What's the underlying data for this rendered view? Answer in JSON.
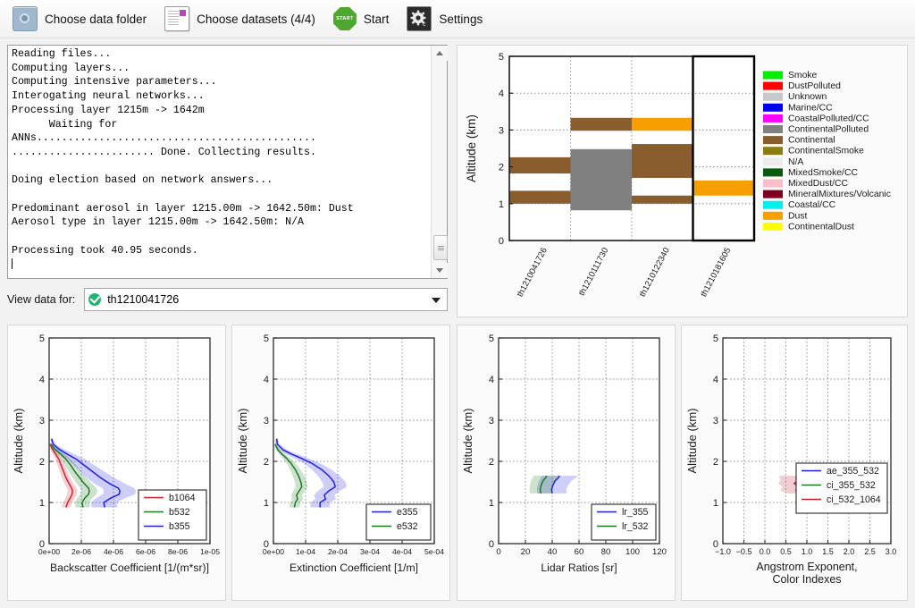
{
  "toolbar": {
    "buttons": [
      {
        "label": "Choose data folder",
        "icon": "folder-icon"
      },
      {
        "label": "Choose datasets (4/4)",
        "icon": "datasets-icon"
      },
      {
        "label": "Start",
        "icon": "start-icon",
        "icon_text": "START"
      },
      {
        "label": "Settings",
        "icon": "gear-icon"
      }
    ]
  },
  "console": {
    "text": "Reading files...\nComputing layers...\nComputing intensive parameters...\nInterogating neural networks...\nProcessing layer 1215m -> 1642m\n      Waiting for\nANNs.............................................\n....................... Done. Collecting results.\n\nDoing election based on network answers...\n\nPredominant aerosol in layer 1215.00m -> 1642.50m: Dust\nAerosol type in layer 1215.00m -> 1642.50m: N/A\n\nProcessing took 40.95 seconds."
  },
  "view_selector": {
    "label": "View data for:",
    "value": "th1210041726",
    "status_icon": "check-circle-icon"
  },
  "chart_data": [
    {
      "id": "classification",
      "type": "bar",
      "title": "",
      "xlabel": "",
      "ylabel": "Altitude (km)",
      "ylim": [
        0,
        5
      ],
      "yticks": [
        0,
        1,
        2,
        3,
        4,
        5
      ],
      "grid": true,
      "categories": [
        "th1210041726",
        "th1210111730",
        "th1210122340",
        "th1210181605"
      ],
      "highlighted_category": "th1210181605",
      "layers": [
        {
          "category": "th1210041726",
          "bottom": 1.0,
          "top": 1.35,
          "type": "Continental",
          "color": "#8a5d2e"
        },
        {
          "category": "th1210041726",
          "bottom": 1.82,
          "top": 2.26,
          "type": "Continental",
          "color": "#8a5d2e"
        },
        {
          "category": "th1210111730",
          "bottom": 0.82,
          "top": 2.48,
          "type": "ContinentalPolluted",
          "color": "#808080"
        },
        {
          "category": "th1210111730",
          "bottom": 2.98,
          "top": 3.33,
          "type": "Continental",
          "color": "#8a5d2e"
        },
        {
          "category": "th1210122340",
          "bottom": 1.0,
          "top": 1.22,
          "type": "Continental",
          "color": "#8a5d2e"
        },
        {
          "category": "th1210122340",
          "bottom": 1.7,
          "top": 2.62,
          "type": "Continental",
          "color": "#8a5d2e"
        },
        {
          "category": "th1210122340",
          "bottom": 2.98,
          "top": 3.33,
          "type": "Dust",
          "color": "#f5a000"
        },
        {
          "category": "th1210181605",
          "bottom": 1.22,
          "top": 1.63,
          "type": "Dust",
          "color": "#f5a000"
        }
      ],
      "legend_position": "right",
      "legend": [
        {
          "label": "Smoke",
          "color": "#00ee00"
        },
        {
          "label": "DustPolluted",
          "color": "#fe0000"
        },
        {
          "label": "Unknown",
          "color": "#c8c8c8"
        },
        {
          "label": "Marine/CC",
          "color": "#0000ee"
        },
        {
          "label": "CoastalPolluted/CC",
          "color": "#ff00ff"
        },
        {
          "label": "ContinentalPolluted",
          "color": "#808080"
        },
        {
          "label": "Continental",
          "color": "#8a5d2e"
        },
        {
          "label": "ContinentalSmoke",
          "color": "#8a7d12"
        },
        {
          "label": "N/A",
          "color": "#ececec"
        },
        {
          "label": "MixedSmoke/CC",
          "color": "#0a5a10"
        },
        {
          "label": "MixedDust/CC",
          "color": "#f9bfc8"
        },
        {
          "label": "MineralMixtures/Volcanic",
          "color": "#800020"
        },
        {
          "label": "Coastal/CC",
          "color": "#00f0f0"
        },
        {
          "label": "Dust",
          "color": "#f5a000"
        },
        {
          "label": "ContinentalDust",
          "color": "#ffff00"
        }
      ]
    },
    {
      "id": "backscatter",
      "type": "line",
      "xlabel": "Backscatter Coefficient [1/(m*sr)]",
      "ylabel": "Altitude (km)",
      "xlim": [
        0,
        1e-05
      ],
      "ylim": [
        0,
        5
      ],
      "xticks": [
        0,
        2e-06,
        4e-06,
        6e-06,
        8e-06,
        1e-05
      ],
      "xticklabels": [
        "0e+00",
        "2e-06",
        "4e-06",
        "6e-06",
        "8e-06",
        "1e-05"
      ],
      "yticks": [
        0,
        1,
        2,
        3,
        4,
        5
      ],
      "grid": true,
      "legend_position": "lower right",
      "series": [
        {
          "name": "b1064",
          "color": "#d02030",
          "y": [
            0.88,
            1.0,
            1.1,
            1.2,
            1.28,
            1.35,
            1.45,
            1.6,
            1.75,
            1.9,
            2.05,
            2.18,
            2.3,
            2.42
          ],
          "x": [
            1.05e-06,
            1.15e-06,
            1.3e-06,
            1.42e-06,
            1.45e-06,
            1.4e-06,
            1.25e-06,
            1.05e-06,
            9e-07,
            7.5e-07,
            6e-07,
            4e-07,
            2e-07,
            6e-08
          ],
          "band": [
            2.8e-07,
            2.8e-07,
            3e-07,
            3e-07,
            3e-07,
            3e-07,
            2.8e-07,
            2.6e-07,
            2.4e-07,
            2.2e-07,
            2e-07,
            1.8e-07,
            1.4e-07,
            8e-08
          ]
        },
        {
          "name": "b532",
          "color": "#1a7a20",
          "y": [
            0.88,
            1.0,
            1.1,
            1.2,
            1.28,
            1.35,
            1.45,
            1.6,
            1.75,
            1.9,
            2.05,
            2.18,
            2.3,
            2.42
          ],
          "x": [
            2.1e-06,
            2.05e-06,
            2.2e-06,
            2.45e-06,
            2.5e-06,
            2.45e-06,
            2.2e-06,
            1.9e-06,
            1.6e-06,
            1.35e-06,
            1.05e-06,
            7e-07,
            3.5e-07,
            1e-07
          ],
          "band": [
            4.5e-07,
            4.5e-07,
            4.8e-07,
            5e-07,
            5e-07,
            5e-07,
            4.8e-07,
            4.4e-07,
            4e-07,
            3.6e-07,
            3e-07,
            2.6e-07,
            2e-07,
            1e-07
          ]
        },
        {
          "name": "b355",
          "color": "#2020dd",
          "y": [
            0.88,
            1.0,
            1.1,
            1.2,
            1.28,
            1.35,
            1.45,
            1.6,
            1.75,
            1.9,
            2.05,
            2.18,
            2.3,
            2.42,
            2.55
          ],
          "x": [
            3.45e-06,
            3.4e-06,
            3.8e-06,
            4.35e-06,
            4.4e-06,
            4.3e-06,
            3.8e-06,
            3.2e-06,
            2.7e-06,
            2.2e-06,
            1.7e-06,
            1.1e-06,
            6e-07,
            2.5e-07,
            1.5e-07
          ],
          "band": [
            8e-07,
            8e-07,
            9e-07,
            1e-06,
            1e-06,
            1e-06,
            9.5e-07,
            8.5e-07,
            7.5e-07,
            6.5e-07,
            5.5e-07,
            4.5e-07,
            3e-07,
            1.5e-07,
            8e-08
          ]
        }
      ]
    },
    {
      "id": "extinction",
      "type": "line",
      "xlabel": "Extinction Coefficient [1/m]",
      "ylabel": "Altitude (km)",
      "xlim": [
        0,
        0.0005
      ],
      "ylim": [
        0,
        5
      ],
      "xticks": [
        0,
        0.0001,
        0.0002,
        0.0003,
        0.0004,
        0.0005
      ],
      "xticklabels": [
        "0e+00",
        "1e-04",
        "2e-04",
        "3e-04",
        "4e-04",
        "5e-04"
      ],
      "yticks": [
        0,
        1,
        2,
        3,
        4,
        5
      ],
      "grid": true,
      "legend_position": "lower right",
      "series": [
        {
          "name": "e355",
          "color": "#2020dd",
          "y": [
            0.88,
            1.0,
            1.08,
            1.18,
            1.28,
            1.38,
            1.5,
            1.65,
            1.8,
            1.95,
            2.08,
            2.18,
            2.28,
            2.42,
            2.55
          ],
          "x": [
            0.000145,
            0.000145,
            0.000162,
            0.000158,
            0.000172,
            0.000192,
            0.000188,
            0.000172,
            0.00015,
            0.00012,
            8.5e-05,
            5.5e-05,
            3e-05,
            1.2e-05,
            1e-05
          ],
          "band": [
            3e-05,
            3e-05,
            3.2e-05,
            3.2e-05,
            3.4e-05,
            3.6e-05,
            3.6e-05,
            3.4e-05,
            3e-05,
            2.6e-05,
            2.2e-05,
            1.8e-05,
            1.2e-05,
            6e-06,
            4e-06
          ]
        },
        {
          "name": "e532",
          "color": "#1a7a20",
          "y": [
            0.88,
            1.0,
            1.08,
            1.18,
            1.28,
            1.38,
            1.5,
            1.65,
            1.8,
            1.95,
            2.08,
            2.18,
            2.28,
            2.42
          ],
          "x": [
            6.5e-05,
            6.8e-05,
            7.5e-05,
            7.2e-05,
            8e-05,
            8.8e-05,
            8.5e-05,
            7.8e-05,
            6.8e-05,
            5.5e-05,
            4e-05,
            2.6e-05,
            1.4e-05,
            5e-06
          ],
          "band": [
            1.6e-05,
            1.6e-05,
            1.7e-05,
            1.7e-05,
            1.8e-05,
            1.9e-05,
            1.9e-05,
            1.8e-05,
            1.6e-05,
            1.4e-05,
            1.2e-05,
            9e-06,
            6e-06,
            3e-06
          ]
        }
      ]
    },
    {
      "id": "lidar_ratios",
      "type": "line",
      "xlabel": "Lidar Ratios [sr]",
      "ylabel": "Altitude (km)",
      "xlim": [
        0,
        120
      ],
      "ylim": [
        0,
        5
      ],
      "xticks": [
        0,
        20,
        40,
        60,
        80,
        100,
        120
      ],
      "yticks": [
        0,
        1,
        2,
        3,
        4,
        5
      ],
      "grid": true,
      "legend_position": "lower right",
      "series": [
        {
          "name": "lr_355",
          "color": "#2020dd",
          "y": [
            1.22,
            1.32,
            1.42,
            1.52,
            1.6,
            1.65
          ],
          "x": [
            40.0,
            39.5,
            40.5,
            42.0,
            44.5,
            45.5
          ],
          "band": [
            11.0,
            11.0,
            11.5,
            12.0,
            13.0,
            13.5
          ]
        },
        {
          "name": "lr_532",
          "color": "#1a7a20",
          "y": [
            1.22,
            1.32,
            1.42,
            1.52,
            1.6,
            1.65
          ],
          "x": [
            31.5,
            31.0,
            31.8,
            33.0,
            35.0,
            36.0
          ],
          "band": [
            8.0,
            8.0,
            8.5,
            9.0,
            9.5,
            10.0
          ]
        }
      ]
    },
    {
      "id": "angstrom",
      "type": "line",
      "xlabel": "Angstrom Exponent,\nColor Indexes",
      "xlabel_line1": "Angstrom Exponent,",
      "xlabel_line2": "Color Indexes",
      "ylabel": "Altitude (km)",
      "xlim": [
        -1.0,
        3.0
      ],
      "ylim": [
        0,
        5
      ],
      "xticks": [
        -1.0,
        -0.5,
        0.0,
        0.5,
        1.0,
        1.5,
        2.0,
        2.5,
        3.0
      ],
      "xticklabels": [
        "−1.0",
        "−0.5",
        "0.0",
        "0.5",
        "1.0",
        "1.5",
        "2.0",
        "2.5",
        "3.0"
      ],
      "yticks": [
        0,
        1,
        2,
        3,
        4,
        5
      ],
      "grid": true,
      "legend_position": "lower right",
      "series": [
        {
          "name": "ae_355_532",
          "color": "#2020dd",
          "y": [
            1.22,
            1.3,
            1.38,
            1.46,
            1.54,
            1.6,
            1.65
          ],
          "x": [
            2.05,
            1.88,
            1.9,
            1.78,
            1.8,
            1.78,
            1.8
          ],
          "band": [
            0.72,
            0.72,
            0.74,
            0.74,
            0.76,
            0.76,
            0.78
          ]
        },
        {
          "name": "ci_355_532",
          "color": "#1a7a20",
          "y": [
            1.22,
            1.3,
            1.38,
            1.46,
            1.54,
            1.6,
            1.65
          ],
          "x": [
            1.33,
            1.33,
            1.34,
            1.34,
            1.35,
            1.36,
            1.36
          ],
          "band": [
            0.4,
            0.4,
            0.41,
            0.41,
            0.42,
            0.42,
            0.43
          ]
        },
        {
          "name": "ci_532_1064",
          "color": "#c02030",
          "y": [
            1.22,
            1.3,
            1.38,
            1.46,
            1.54,
            1.6,
            1.65
          ],
          "x": [
            0.92,
            0.74,
            0.82,
            0.7,
            0.78,
            0.74,
            0.76
          ],
          "band": [
            0.38,
            0.38,
            0.39,
            0.39,
            0.4,
            0.4,
            0.41
          ]
        }
      ]
    }
  ]
}
